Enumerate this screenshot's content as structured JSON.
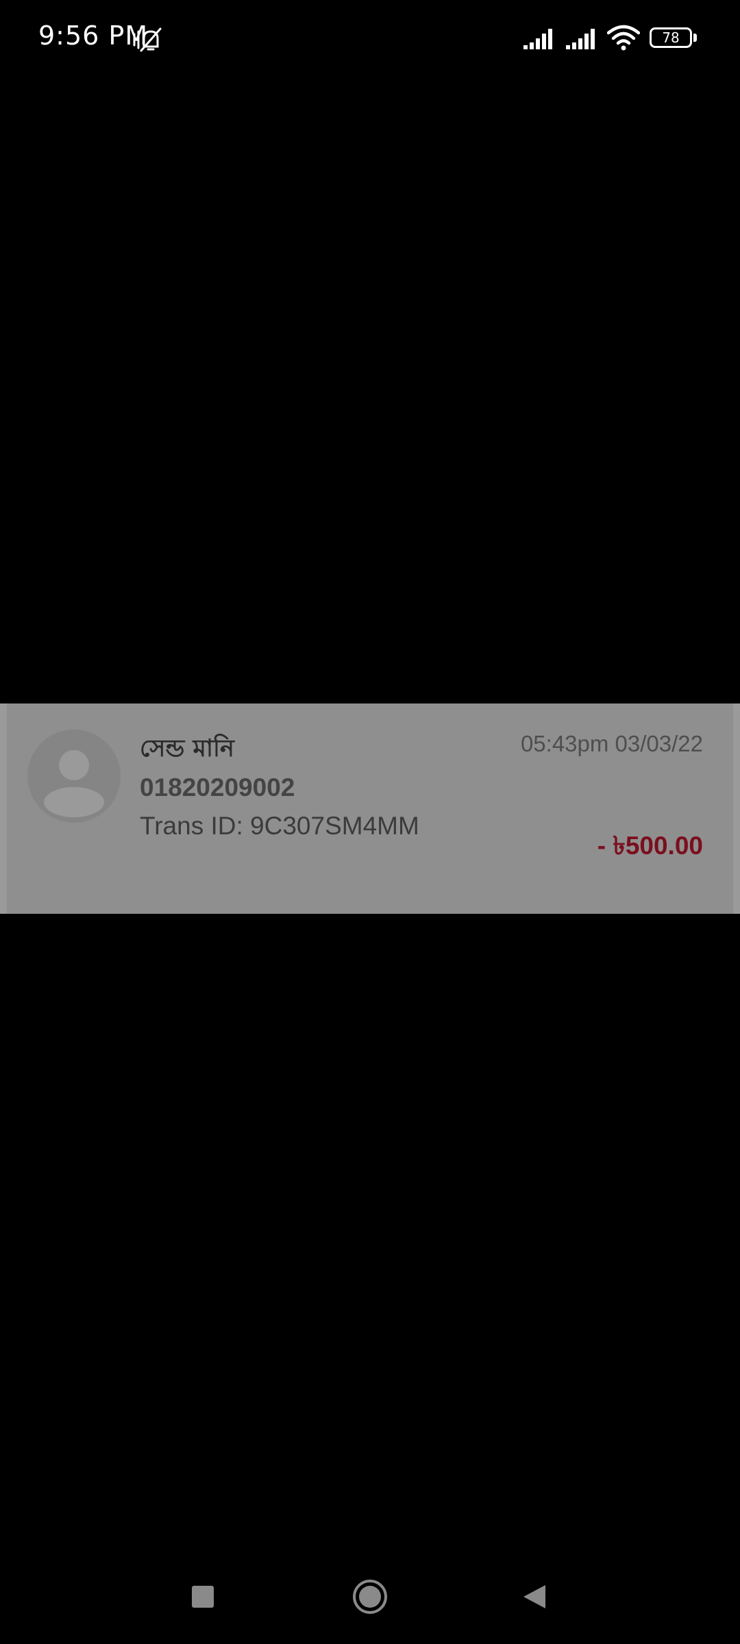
{
  "status_bar": {
    "time": "9:56 PM",
    "battery_level": "78",
    "icons": [
      "vibrate-off-icon",
      "signal-icon",
      "signal-icon",
      "wifi-icon",
      "battery-icon"
    ]
  },
  "transaction": {
    "title": "সেন্ড মানি",
    "phone": "01820209002",
    "trans_id": "Trans ID: 9C307SM4MM",
    "datetime": "05:43pm 03/03/22",
    "amount": "- ৳500.00",
    "avatar_icon": "user-avatar-icon",
    "colors": {
      "amount": "#7a0f1e",
      "card_background": "#8f8f8f"
    }
  },
  "navigation": {
    "buttons": [
      "recents-button",
      "home-button",
      "back-button"
    ]
  }
}
